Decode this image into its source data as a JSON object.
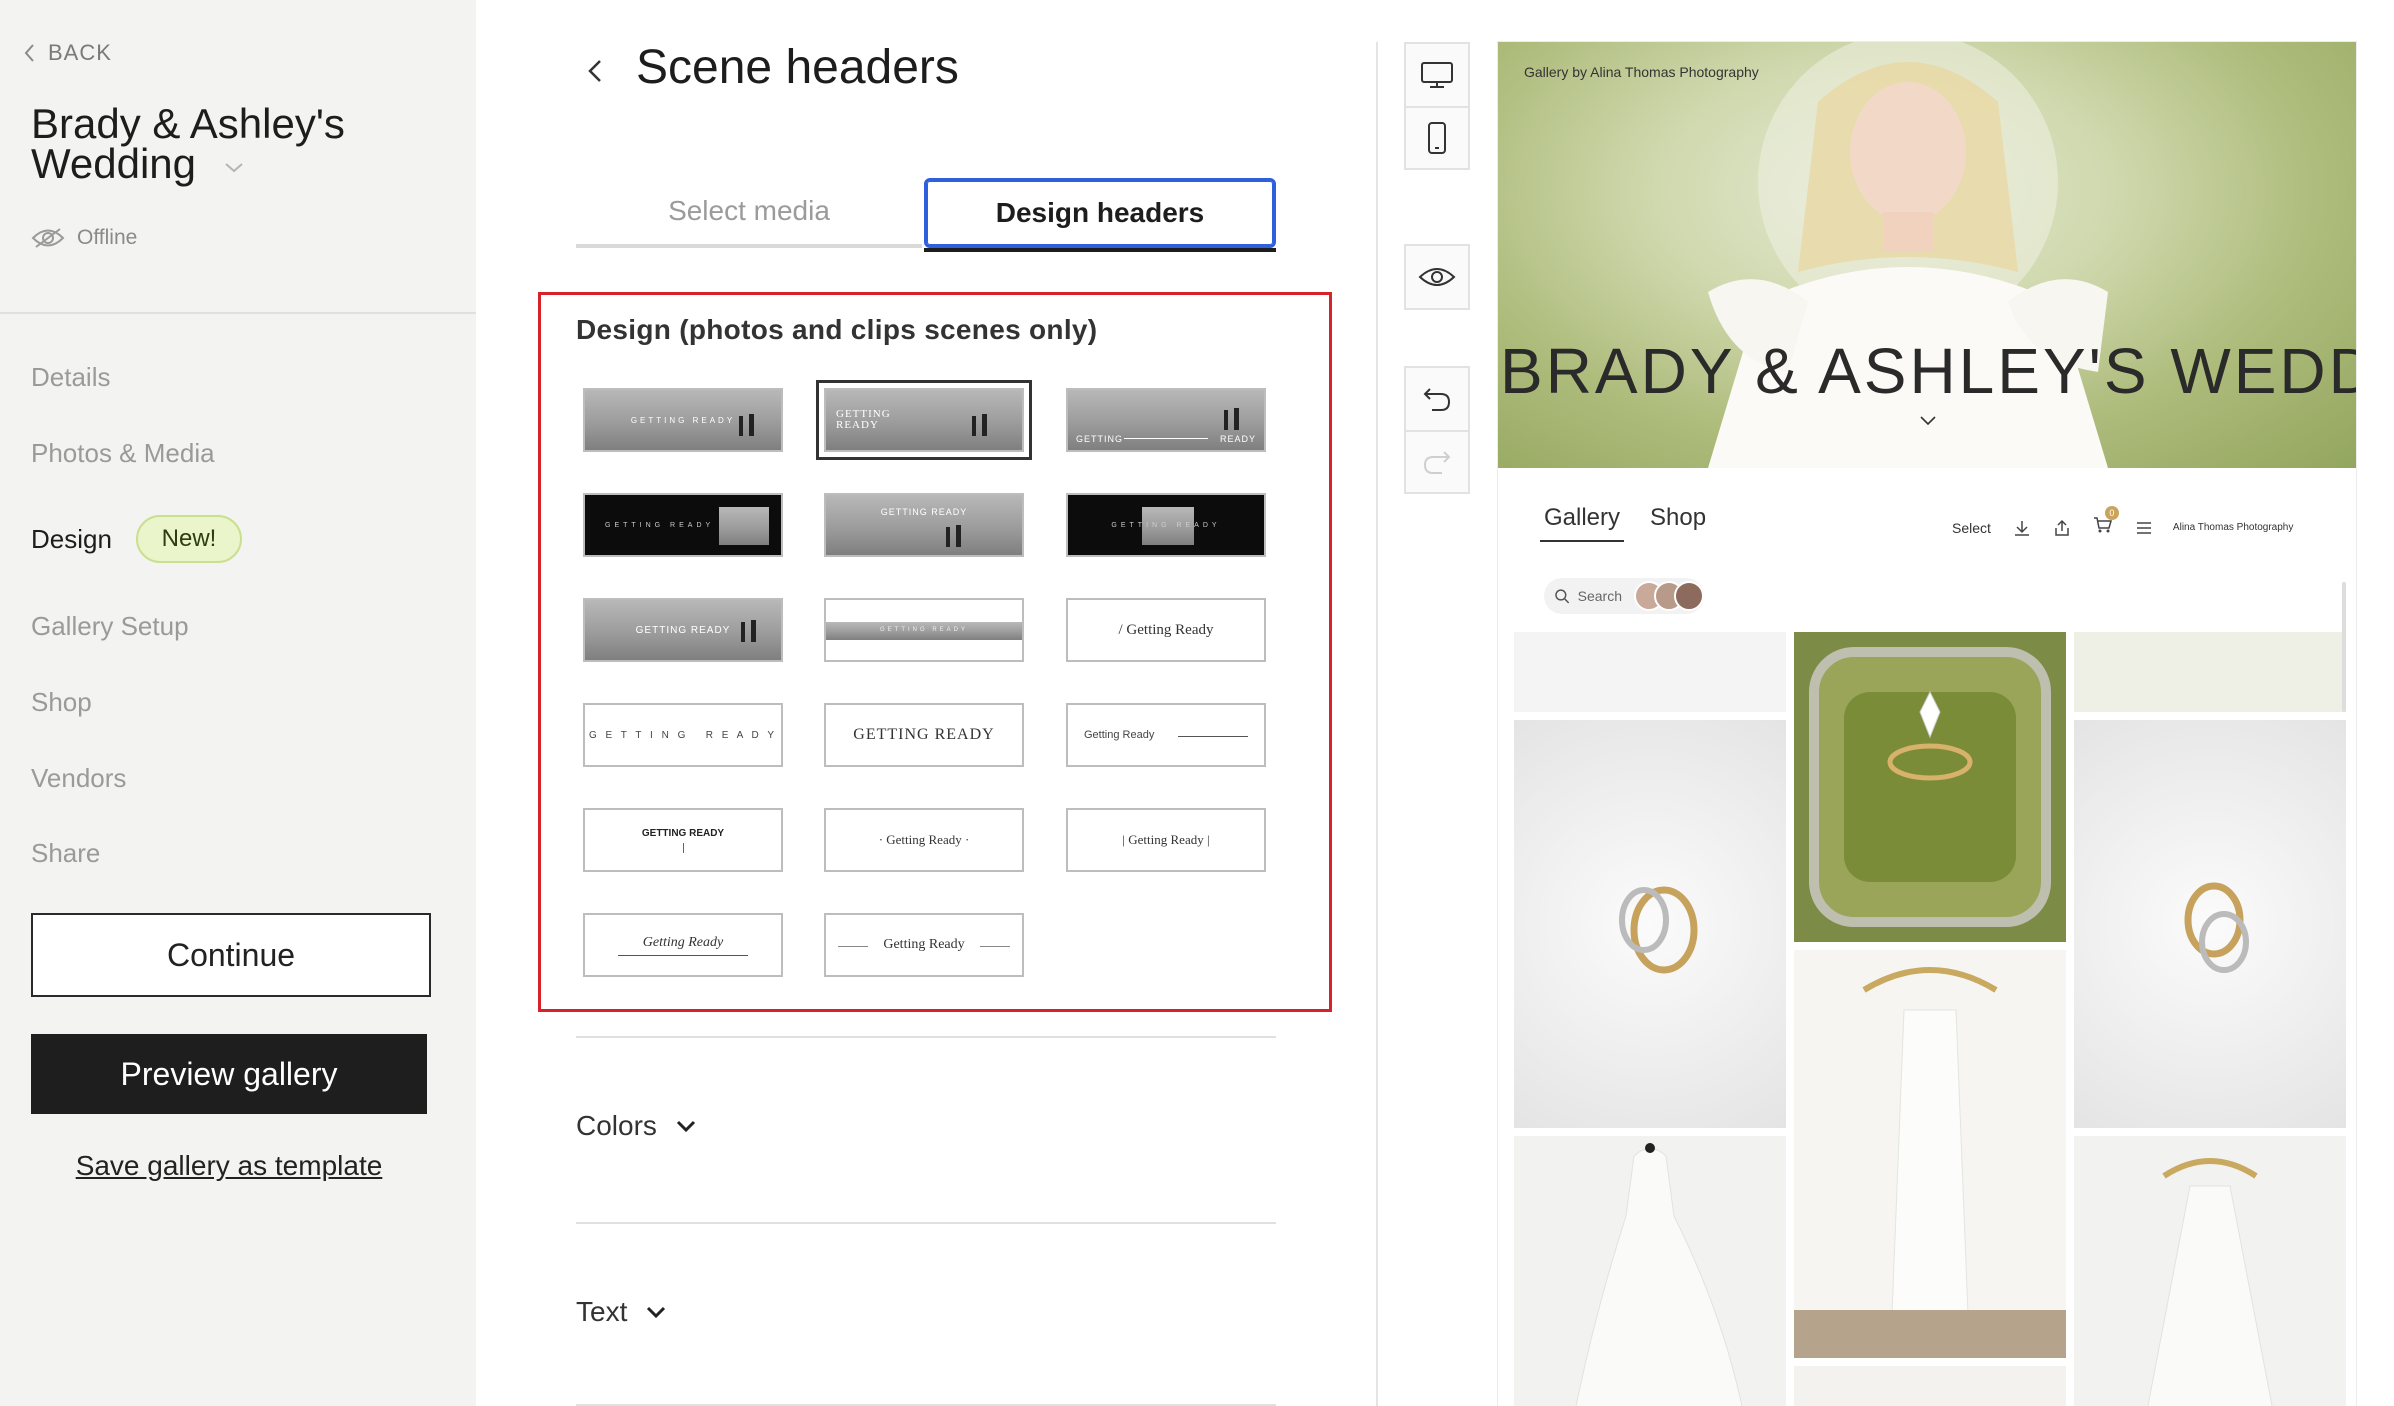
{
  "sidebar": {
    "back": "BACK",
    "title_line1": "Brady & Ashley's",
    "title_line2": "Wedding",
    "status": "Offline",
    "nav": [
      "Details",
      "Photos & Media",
      "Design",
      "Gallery Setup",
      "Shop",
      "Vendors",
      "Share"
    ],
    "active_nav": "Design",
    "new_badge": "New!",
    "continue": "Continue",
    "preview": "Preview gallery",
    "save_template": "Save gallery as template"
  },
  "main": {
    "title": "Scene headers",
    "tabs": [
      "Select media",
      "Design headers"
    ],
    "active_tab": "Design headers",
    "design_heading": "Design (photos and clips scenes only)",
    "thumbnails": [
      {
        "text": "GETTING READY",
        "style": "photo"
      },
      {
        "text": "GETTING READY",
        "style": "photo-left",
        "selected": true
      },
      {
        "text": "GETTING",
        "text2": "READY",
        "style": "photo-split"
      },
      {
        "text": "GETTING READY",
        "style": "dark-inset-right"
      },
      {
        "text": "GETTING READY",
        "style": "photo-top"
      },
      {
        "text": "GETTING READY",
        "style": "dark-inset-center"
      },
      {
        "text": "GETTING READY",
        "style": "photo-center"
      },
      {
        "text": "GETTING READY",
        "style": "band"
      },
      {
        "text": "/ Getting Ready",
        "style": "serif"
      },
      {
        "text": "G E T T I N G   R E A D Y",
        "style": "spaced"
      },
      {
        "text": "GETTING READY",
        "style": "serif-caps"
      },
      {
        "text": "Getting Ready",
        "style": "left-line"
      },
      {
        "text": "GETTING READY",
        "style": "bold-small"
      },
      {
        "text": "· Getting Ready ·",
        "style": "dots"
      },
      {
        "text": "| Getting Ready |",
        "style": "bars"
      },
      {
        "text": "Getting Ready",
        "style": "underline-script"
      },
      {
        "text": "Getting Ready",
        "style": "side-lines"
      }
    ],
    "accordions": [
      "Colors",
      "Text"
    ]
  },
  "tools": {
    "icons": [
      "desktop-icon",
      "mobile-icon",
      "eye-icon",
      "undo-icon",
      "redo-icon"
    ]
  },
  "preview": {
    "credit": "Gallery by Alina Thomas Photography",
    "hero_title": "BRADY & ASHLEY'S WEDDING",
    "nav": [
      "Gallery",
      "Shop"
    ],
    "select": "Select",
    "cart_count": "0",
    "brand": "Alina Thomas Photography",
    "search": "Search"
  },
  "colors": {
    "accent_blue": "#2e5fdc",
    "highlight_red": "#d6232a",
    "badge_green": "#eaf5cc"
  }
}
